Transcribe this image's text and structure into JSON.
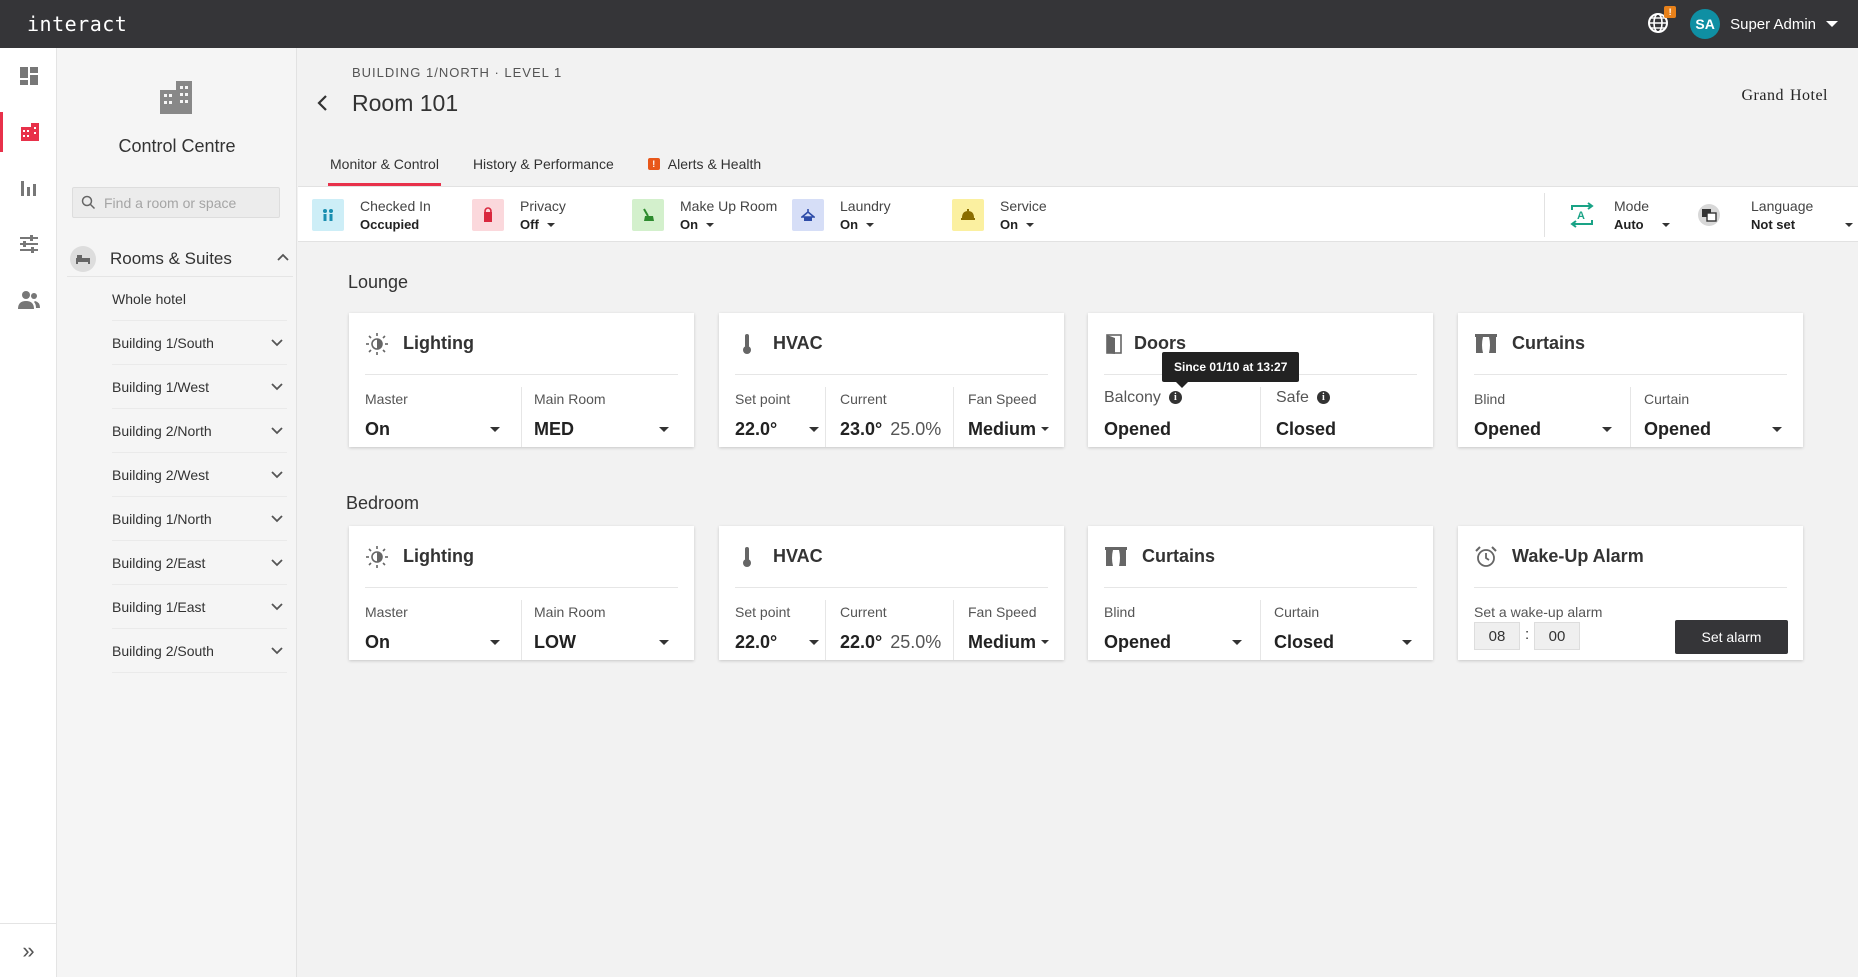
{
  "app": {
    "brand": "interact"
  },
  "user": {
    "initials": "SA",
    "name": "Super Admin",
    "notification_badge": "!"
  },
  "rail": {
    "items": [
      {
        "icon": "dashboard-icon"
      },
      {
        "icon": "building-icon",
        "active": true
      },
      {
        "icon": "bar-chart-icon"
      },
      {
        "icon": "sliders-icon"
      },
      {
        "icon": "users-icon"
      }
    ],
    "expand_glyph": "»"
  },
  "sidebar": {
    "title": "Control Centre",
    "search_placeholder": "Find a room or space",
    "rooms_label": "Rooms & Suites",
    "items": [
      "Whole hotel",
      "Building 1/South",
      "Building 1/West",
      "Building 2/North",
      "Building 2/West",
      "Building 1/North",
      "Building 2/East",
      "Building 1/East",
      "Building 2/South"
    ]
  },
  "header": {
    "breadcrumb": "BUILDING 1/NORTH · LEVEL 1",
    "room_title": "Room 101",
    "logo_left": "Grand",
    "logo_right": "Hotel"
  },
  "tabs": [
    {
      "label": "Monitor & Control",
      "active": true
    },
    {
      "label": "History & Performance"
    },
    {
      "label": "Alerts & Health",
      "warning": "!"
    }
  ],
  "status": {
    "checked_in": {
      "label": "Checked In",
      "value": "Occupied"
    },
    "privacy": {
      "label": "Privacy",
      "value": "Off"
    },
    "make_up": {
      "label": "Make Up Room",
      "value": "On"
    },
    "laundry": {
      "label": "Laundry",
      "value": "On"
    },
    "service": {
      "label": "Service",
      "value": "On"
    },
    "mode": {
      "label": "Mode",
      "value": "Auto"
    },
    "language": {
      "label": "Language",
      "value": "Not set"
    }
  },
  "colors": {
    "accent": "#e8314a",
    "dark": "#353538",
    "avatar": "#0f8fa3"
  },
  "lounge": {
    "title": "Lounge",
    "lighting": {
      "title": "Lighting",
      "c1_label": "Master",
      "c1_value": "On",
      "c2_label": "Main Room",
      "c2_value": "MED"
    },
    "hvac": {
      "title": "HVAC",
      "setpoint_label": "Set point",
      "setpoint": "22.0°",
      "current_label": "Current",
      "current": "23.0°",
      "humidity": "25.0%",
      "fan_label": "Fan Speed",
      "fan": "Medium"
    },
    "doors": {
      "title": "Doors",
      "c1_label": "Balcony",
      "c1_value": "Opened",
      "c2_label": "Safe",
      "c2_value": "Closed",
      "tooltip": "Since 01/10 at 13:27"
    },
    "curtains": {
      "title": "Curtains",
      "c1_label": "Blind",
      "c1_value": "Opened",
      "c2_label": "Curtain",
      "c2_value": "Opened"
    }
  },
  "bedroom": {
    "title": "Bedroom",
    "lighting": {
      "title": "Lighting",
      "c1_label": "Master",
      "c1_value": "On",
      "c2_label": "Main Room",
      "c2_value": "LOW"
    },
    "hvac": {
      "title": "HVAC",
      "setpoint_label": "Set point",
      "setpoint": "22.0°",
      "current_label": "Current",
      "current": "22.0°",
      "humidity": "25.0%",
      "fan_label": "Fan Speed",
      "fan": "Medium"
    },
    "curtains": {
      "title": "Curtains",
      "c1_label": "Blind",
      "c1_value": "Opened",
      "c2_label": "Curtain",
      "c2_value": "Closed"
    },
    "alarm": {
      "title": "Wake-Up Alarm",
      "label": "Set a wake-up alarm",
      "hour": "08",
      "minute": "00",
      "separator": ":",
      "button": "Set alarm"
    }
  }
}
